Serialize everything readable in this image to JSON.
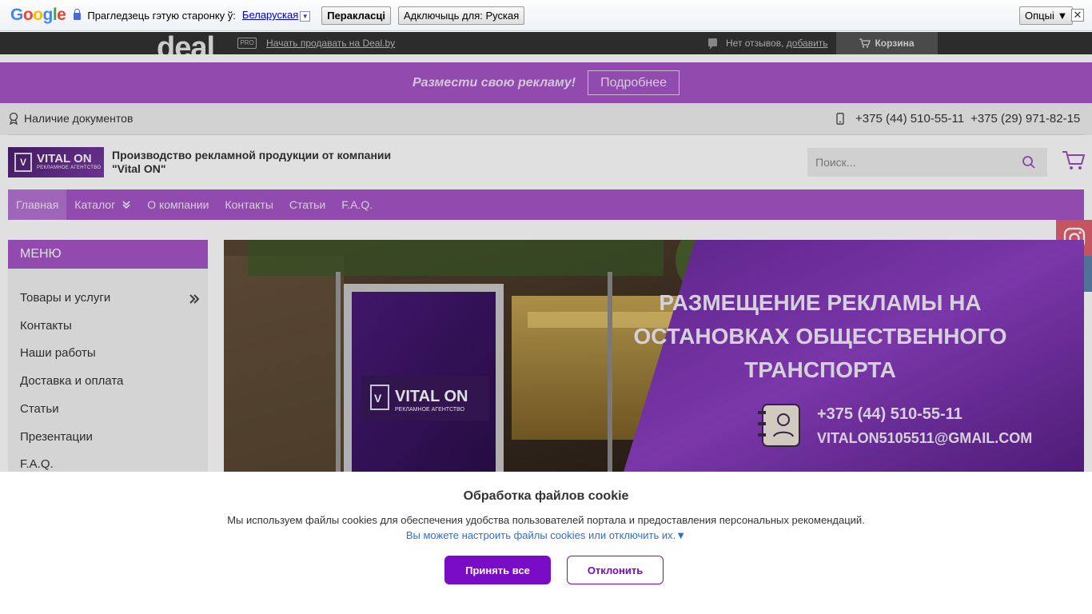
{
  "translate_bar": {
    "logo": "Google",
    "prompt": "Прагледзець гэтую старонку ў:",
    "language": "Беларуская",
    "dropdown_glyph": "▼",
    "translate_button": "Перакласці",
    "disable_button": "Адключыць для: Руская",
    "options_button": "Опцыі ▼",
    "close_glyph": "✕"
  },
  "deal_bar": {
    "logo": "deal",
    "pro_badge": "PRO",
    "sell_link": "Начать продавать на Deal.by",
    "reviews_text": "Нет отзывов,",
    "reviews_link": "добавить",
    "cart_label": "Корзина"
  },
  "promo": {
    "text": "Размести свою рекламу!",
    "button": "Подробнее"
  },
  "info": {
    "documents": "Наличие документов",
    "phone_1": "+375 (44) 510-55-11",
    "phone_2": "+375 (29) 971-82-15"
  },
  "header": {
    "logo_mark": "V",
    "logo_name": "VITAL ON",
    "logo_tagline": "РЕКЛАМНОЕ АГЕНТСТВО",
    "title": "Производство рекламной продукции от компании \"Vital ON\"",
    "search_placeholder": "Поиск..."
  },
  "nav": {
    "items": [
      "Главная",
      "Каталог",
      "О компании",
      "Контакты",
      "Статьи",
      "F.A.Q."
    ]
  },
  "sidebar": {
    "title": "МЕНЮ",
    "items": [
      "Товары и услуги",
      "Контакты",
      "Наши работы",
      "Доставка и оплата",
      "Статьи",
      "Презентации",
      "F.A.Q."
    ]
  },
  "banner": {
    "line1": "РАЗМЕЩЕНИЕ РЕКЛАМЫ НА",
    "line2": "ОСТАНОВКАХ ОБЩЕСТВЕННОГО",
    "line3": "ТРАНСПОРТА",
    "phone": "+375 (44) 510-55-11",
    "email": "VITALON5105511@GMAIL.COM",
    "poster_name": "VITAL ON",
    "poster_tagline": "РЕКЛАМНОЕ АГЕНТСТВО"
  },
  "cookie": {
    "title": "Обработка файлов cookie",
    "text": "Мы используем файлы cookies для обеспечения удобства пользователей портала и предоставления персональных рекомендаций.",
    "link": "Вы можете настроить файлы cookies или отключить их.▼",
    "accept": "Принять все",
    "decline": "Отклонить"
  },
  "colors": {
    "accent": "#a555c6",
    "button": "#7a0bc7",
    "link": "#2b6fd6"
  }
}
